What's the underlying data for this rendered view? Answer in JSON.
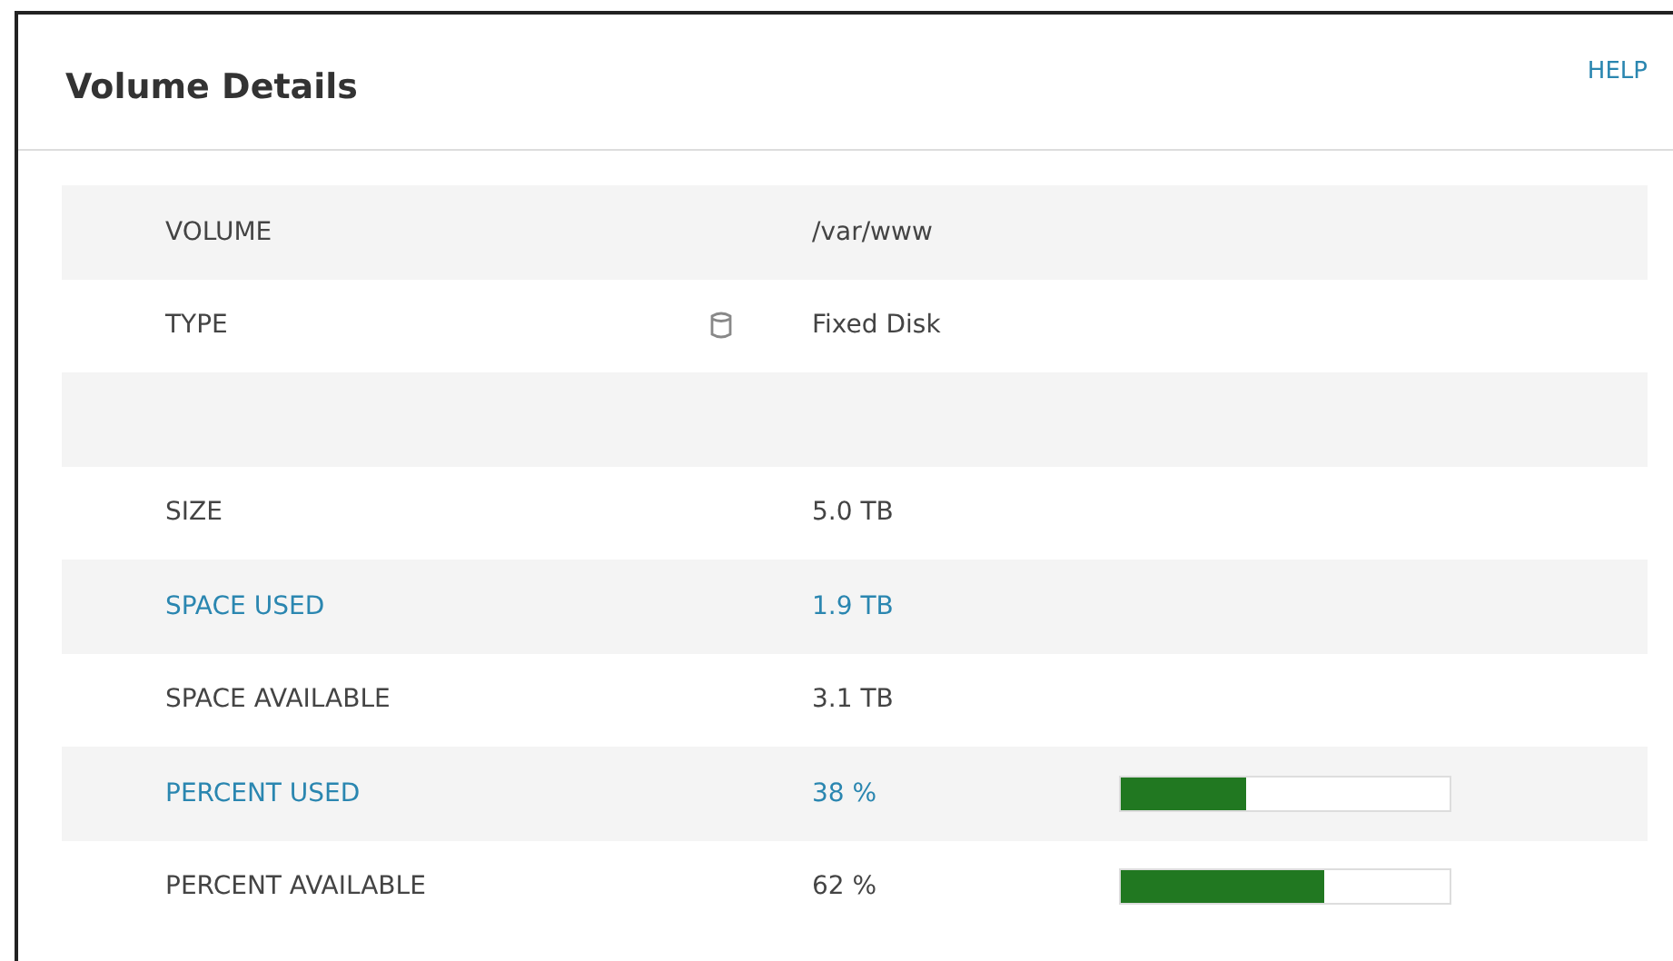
{
  "panel": {
    "title": "Volume Details",
    "help": "HELP"
  },
  "rows": [
    {
      "kind": "text",
      "label": "VOLUME",
      "value": "/var/www",
      "highlighted": false
    },
    {
      "kind": "icon",
      "label": "TYPE",
      "value": "Fixed Disk",
      "highlighted": false
    },
    {
      "kind": "blank"
    },
    {
      "kind": "text",
      "label": "SIZE",
      "value": "5.0 TB",
      "highlighted": false
    },
    {
      "kind": "text",
      "label": "SPACE USED",
      "value": "1.9 TB",
      "highlighted": true
    },
    {
      "kind": "text",
      "label": "SPACE AVAILABLE",
      "value": "3.1 TB",
      "highlighted": false
    },
    {
      "kind": "bar",
      "label": "PERCENT USED",
      "value": "38 %",
      "highlighted": true,
      "level": 0.38
    },
    {
      "kind": "bar",
      "label": "PERCENT AVAILABLE",
      "value": "62 %",
      "highlighted": false,
      "level": 0.62
    }
  ]
}
